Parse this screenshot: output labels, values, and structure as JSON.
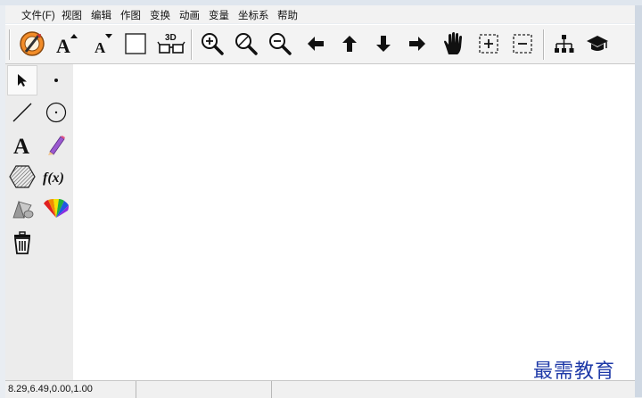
{
  "menu": {
    "items": [
      "文件(F)",
      "视图",
      "编辑",
      "作图",
      "变换",
      "动画",
      "变量",
      "坐标系",
      "帮助"
    ]
  },
  "toolbar": {
    "icons": [
      "logo-icon",
      "font-larger-icon",
      "font-smaller-icon",
      "rectangle-icon",
      "3d-glasses-icon",
      "zoom-in-icon",
      "zoom-fit-icon",
      "zoom-out-icon",
      "arrow-left-icon",
      "arrow-up-icon",
      "arrow-down-icon",
      "arrow-right-icon",
      "hand-pan-icon",
      "expand-icon",
      "collapse-icon",
      "hierarchy-icon",
      "graduation-cap-icon"
    ],
    "font_larger_label": "A",
    "font_smaller_label": "A",
    "three_d_label": "3D"
  },
  "tools": {
    "text_tool_label": "A",
    "function_tool_label": "f(x)"
  },
  "status": {
    "coordinates": "8.29,6.49,0.00,1.00"
  },
  "watermark": {
    "text": "最需教育"
  },
  "colors": {
    "canvas_bg": "#ffffff",
    "panel_bg": "#ececec",
    "watermark": "#1f3aa8"
  }
}
